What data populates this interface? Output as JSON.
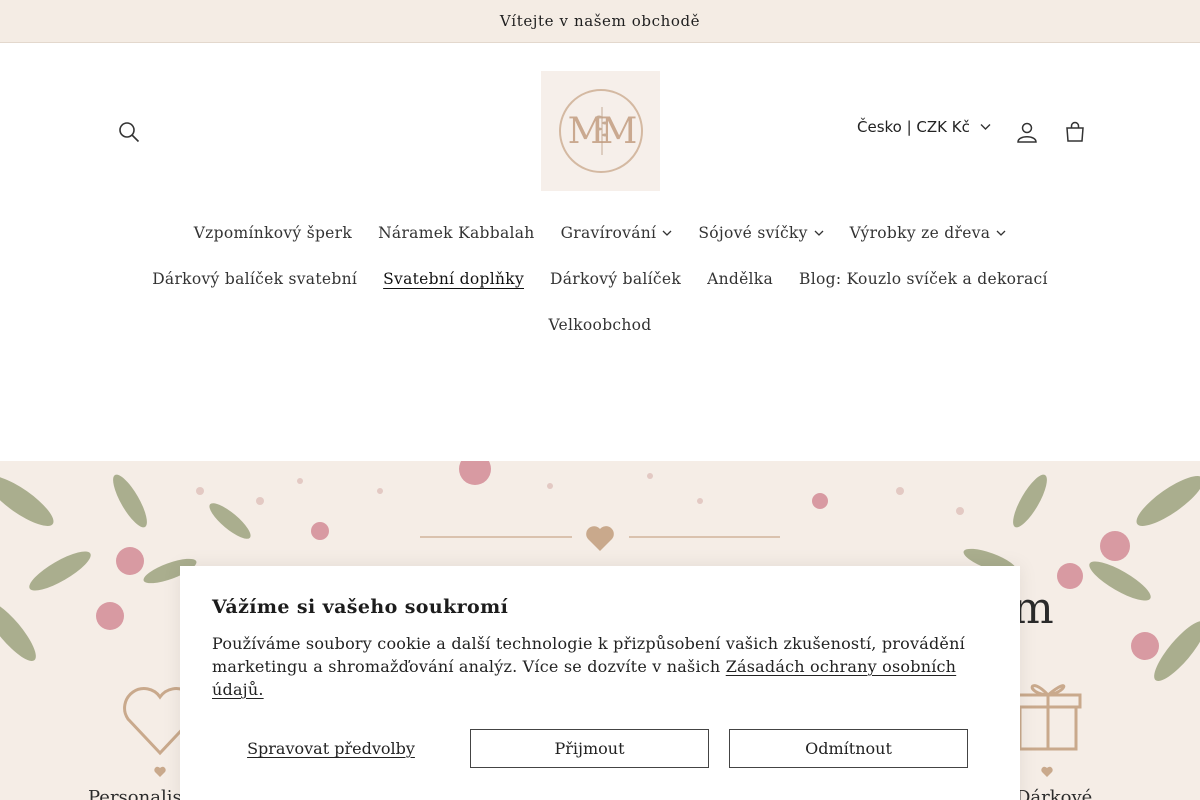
{
  "announcement": "Vítejte v našem obchodě",
  "header": {
    "logo_text": "MM",
    "locale": "Česko | CZK Kč"
  },
  "nav": {
    "row1": [
      {
        "label": "Vzpomínkový šperk",
        "dropdown": false
      },
      {
        "label": "Náramek Kabbalah",
        "dropdown": false
      },
      {
        "label": "Gravírování",
        "dropdown": true
      },
      {
        "label": "Sójové svíčky",
        "dropdown": true
      },
      {
        "label": "Výrobky ze dřeva",
        "dropdown": true
      }
    ],
    "row2": [
      {
        "label": "Dárkový balíček svatební",
        "dropdown": false
      },
      {
        "label": "Svatební doplňky",
        "dropdown": false,
        "active": true
      },
      {
        "label": "Dárkový balíček",
        "dropdown": false
      },
      {
        "label": "Andělka",
        "dropdown": false
      },
      {
        "label": "Blog: Kouzlo svíček a dekorací",
        "dropdown": false
      }
    ],
    "row3": [
      {
        "label": "Velkoobchod",
        "dropdown": false
      }
    ]
  },
  "hero": {
    "left_feature": "Personalis",
    "right_feature": "Dárkové",
    "title_fragment": "m"
  },
  "cookie": {
    "title": "Vážíme si vašeho soukromí",
    "text": "Používáme soubory cookie a další technologie k přizpůsobení vašich zkušeností, provádění marketingu a shromažďování analýz. Více se dozvíte v našich ",
    "link": "Zásadách ochrany osobních údajů.",
    "manage": "Spravovat předvolby",
    "accept": "Přijmout",
    "decline": "Odmítnout"
  },
  "colors": {
    "announce_bg": "#f4ece4",
    "hero_bg": "#f5ede6",
    "accent": "#c9a98c"
  }
}
